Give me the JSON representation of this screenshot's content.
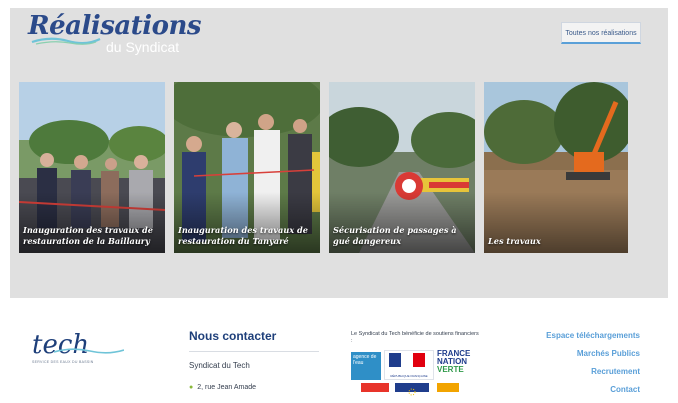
{
  "header": {
    "title": "Réalisations",
    "subtitle": "du Syndicat",
    "all_button": "Toutes nos réalisations"
  },
  "cards": [
    {
      "caption": "Inauguration des travaux de restauration de la Baillaury"
    },
    {
      "caption": "Inauguration des travaux de restauration du Tanyaré"
    },
    {
      "caption": "Sécurisation de passages à gué dangereux"
    },
    {
      "caption": "Les travaux"
    }
  ],
  "footer": {
    "logo_text": "tech",
    "logo_tagline": "SERVICE DES EAUX DU BASSIN",
    "contact_title": "Nous contacter",
    "org_name": "Syndicat du Tech",
    "address": "2, rue Jean Amade",
    "funders_text": "Le Syndicat du Tech bénéficie de soutiens financiers :",
    "funders": {
      "agence": "agence de l'eau",
      "republique": "RÉPUBLIQUE FRANÇAISE",
      "fnv_line1": "FRANCE",
      "fnv_line2": "NATION",
      "fnv_line3": "VERTE"
    },
    "links": [
      "Espace téléchargements",
      "Marchés Publics",
      "Recrutement",
      "Contact"
    ]
  },
  "colors": {
    "accent": "#5a9fd8",
    "navy": "#1e3f7a",
    "hero_bg": "#e0e0e0",
    "green": "#8ab83a"
  }
}
